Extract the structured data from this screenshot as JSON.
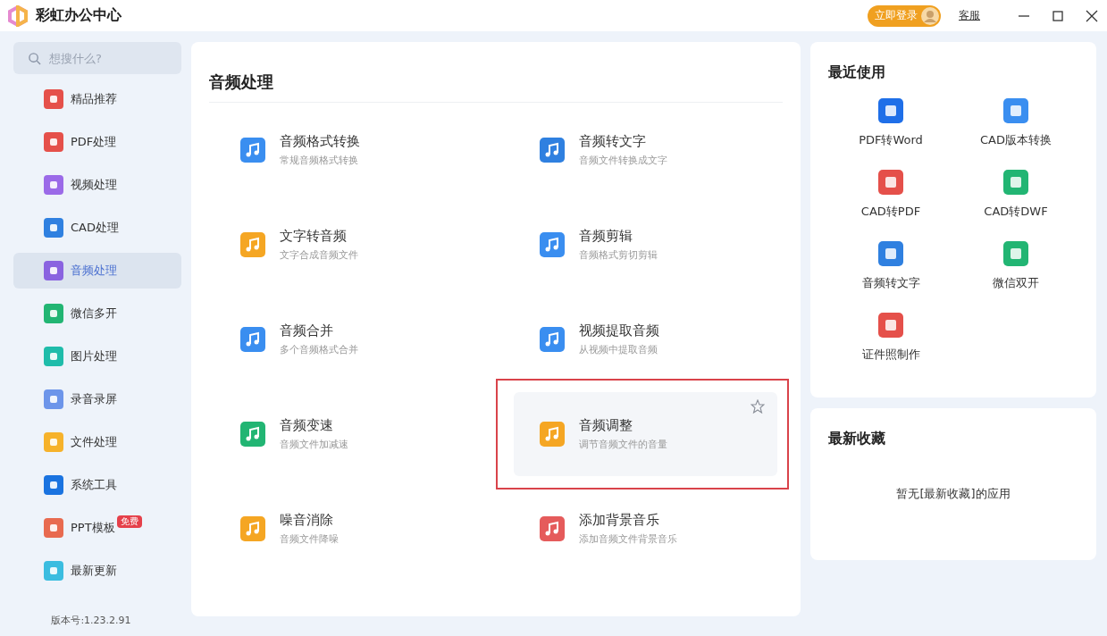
{
  "window": {
    "title": "彩虹办公中心",
    "login_button": "立即登录",
    "support_link": "客服"
  },
  "sidebar": {
    "search": {
      "placeholder": "想搜什么?"
    },
    "items": [
      {
        "label": "精品推荐",
        "color": "#e5504a",
        "selected": false
      },
      {
        "label": "PDF处理",
        "color": "#e5504a",
        "selected": false
      },
      {
        "label": "视频处理",
        "color": "#9b6ae8",
        "selected": false
      },
      {
        "label": "CAD处理",
        "color": "#2f80e0",
        "selected": false
      },
      {
        "label": "音频处理",
        "color": "#8a63e0",
        "selected": true
      },
      {
        "label": "微信多开",
        "color": "#22b573",
        "selected": false
      },
      {
        "label": "图片处理",
        "color": "#1fbcaa",
        "selected": false
      },
      {
        "label": "录音录屏",
        "color": "#6d95ea",
        "selected": false
      },
      {
        "label": "文件处理",
        "color": "#f6b22b",
        "selected": false
      },
      {
        "label": "系统工具",
        "color": "#1a73e0",
        "selected": false
      },
      {
        "label": "PPT模板",
        "color": "#e86a4f",
        "selected": false,
        "badge": "免费"
      },
      {
        "label": "最新更新",
        "color": "#3bbde0",
        "selected": false
      }
    ],
    "version": "版本号:1.23.2.91"
  },
  "main": {
    "title": "音频处理",
    "tools": [
      {
        "name": "音频格式转换",
        "description": "常规音频格式转换",
        "color": "#3a8ef0",
        "highlighted": false
      },
      {
        "name": "音频转文字",
        "description": "音频文件转换成文字",
        "color": "#2f80e0",
        "highlighted": false
      },
      {
        "name": "文字转音频",
        "description": "文字合成音频文件",
        "color": "#f5a623",
        "highlighted": false
      },
      {
        "name": "音频剪辑",
        "description": "音频格式剪切剪辑",
        "color": "#3a8ef0",
        "highlighted": false
      },
      {
        "name": "音频合并",
        "description": "多个音频格式合并",
        "color": "#3a8ef0",
        "highlighted": false
      },
      {
        "name": "视频提取音频",
        "description": "从视频中提取音频",
        "color": "#3a8ef0",
        "highlighted": false
      },
      {
        "name": "音频变速",
        "description": "音频文件加减速",
        "color": "#22b573",
        "highlighted": false
      },
      {
        "name": "音频调整",
        "description": "调节音频文件的音量",
        "color": "#f5a623",
        "highlighted": true
      },
      {
        "name": "噪音消除",
        "description": "音频文件降噪",
        "color": "#f5a623",
        "highlighted": false
      },
      {
        "name": "添加背景音乐",
        "description": "添加音频文件背景音乐",
        "color": "#e55b5b",
        "highlighted": false
      }
    ]
  },
  "recent": {
    "title": "最近使用",
    "items": [
      {
        "label": "PDF转Word",
        "color": "#1f6fe8"
      },
      {
        "label": "CAD版本转换",
        "color": "#3a8ef0"
      },
      {
        "label": "CAD转PDF",
        "color": "#e5504a"
      },
      {
        "label": "CAD转DWF",
        "color": "#22b573"
      },
      {
        "label": "音频转文字",
        "color": "#2f80e0"
      },
      {
        "label": "微信双开",
        "color": "#22b573"
      },
      {
        "label": "证件照制作",
        "color": "#e5504a"
      }
    ]
  },
  "favorites": {
    "title": "最新收藏",
    "empty_text": "暂无[最新收藏]的应用"
  }
}
